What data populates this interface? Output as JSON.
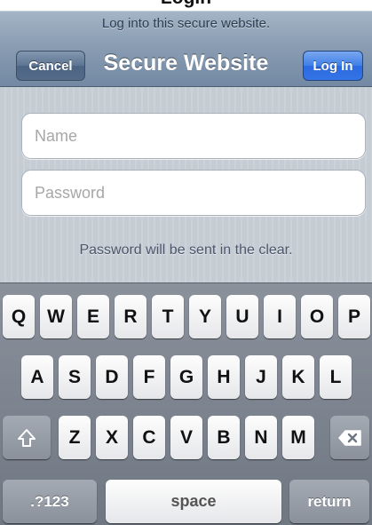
{
  "page": {
    "cut_title": "Login"
  },
  "navbar": {
    "prompt": "Log into this secure website.",
    "title": "Secure Website",
    "cancel_label": "Cancel",
    "login_label": "Log In"
  },
  "form": {
    "name_placeholder": "Name",
    "password_placeholder": "Password",
    "clear_note": "Password will be sent in the clear."
  },
  "keyboard": {
    "row1": [
      "Q",
      "W",
      "E",
      "R",
      "T",
      "Y",
      "U",
      "I",
      "O",
      "P"
    ],
    "row2": [
      "A",
      "S",
      "D",
      "F",
      "G",
      "H",
      "J",
      "K",
      "L"
    ],
    "row3": [
      "Z",
      "X",
      "C",
      "V",
      "B",
      "N",
      "M"
    ],
    "numbers_label": ".?123",
    "space_label": "space",
    "return_label": "return",
    "shift_icon": "shift-arrow-icon",
    "delete_icon": "backspace-icon"
  },
  "colors": {
    "navbar": "#8a9db3",
    "login_button": "#3f7fe6",
    "form_background": "#c5ccd4",
    "keyboard_background": "#7a818c"
  }
}
